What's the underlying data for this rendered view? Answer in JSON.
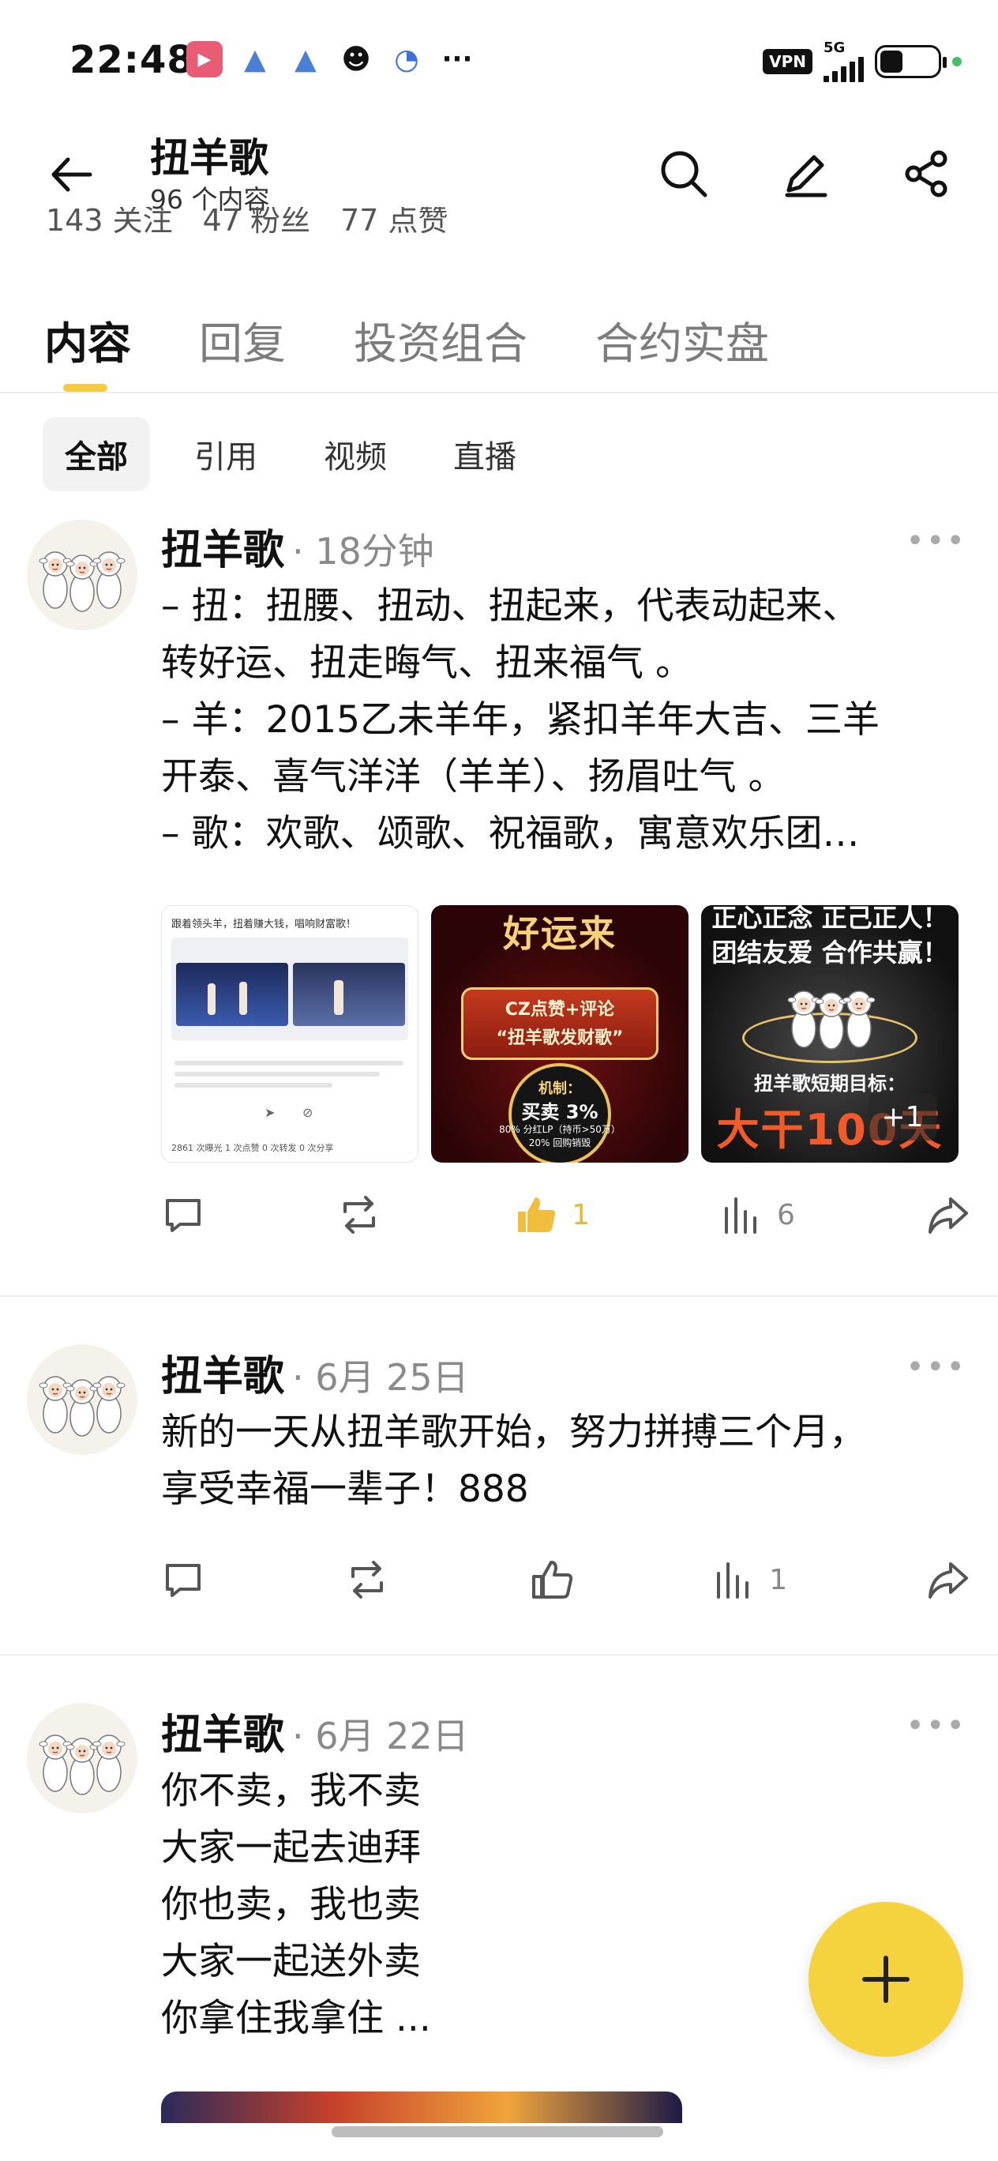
{
  "status_bar": {
    "time": "22:48",
    "vpn": "VPN",
    "network": "5G"
  },
  "header": {
    "title": "扭羊歌",
    "subtitle": "96 个内容"
  },
  "stats": [
    "143 关注",
    "47 粉丝",
    "77 点赞"
  ],
  "tabs": [
    {
      "label": "内容",
      "active": true
    },
    {
      "label": "回复"
    },
    {
      "label": "投资组合"
    },
    {
      "label": "合约实盘"
    }
  ],
  "filters": [
    "全部",
    "引用",
    "视频",
    "直播"
  ],
  "posts": [
    {
      "author": "扭羊歌",
      "time": "· 18分钟",
      "content": "– 扭：扭腰、扭动、扭起来，代表动起来、\n转好运、扭走晦气、扭来福气 。\n– 羊：2015乙未羊年，紧扣羊年大吉、三羊\n开泰、喜气洋洋（羊羊）、扬眉吐气 。\n– 歌：欢歌、颂歌、祝福歌，寓意欢乐团…",
      "images": {
        "img1_caption": "跟着领头羊，扭着赚大钱，唱响财富歌！",
        "img1_stats": "2861 次曝光  1 次点赞  0 次转发  0 次分享",
        "img2_top": "好运来",
        "img2_badge": "CZ点赞+评论\n“扭羊歌发财歌”",
        "img2_mech": "机制：",
        "img2_rate": "买卖 3%",
        "img2_lines": "80% 分红LP（持币>50万）\n20% 回购销毁",
        "img3_top": "正心正念 正己正人！\n团结友爱 合作共赢！",
        "img3_goal": "扭羊歌短期目标：",
        "img3_big": "大干100天",
        "img3_more": "+1"
      },
      "likes": "1",
      "views": "6"
    },
    {
      "author": "扭羊歌",
      "time": "· 6月 25日",
      "content": "新的一天从扭羊歌开始，努力拼搏三个月，\n享受幸福一辈子！888",
      "likes": "",
      "views": "1"
    },
    {
      "author": "扭羊歌",
      "time": "· 6月 22日",
      "content": "你不卖，我不卖\n大家一起去迪拜\n你也卖，我也卖\n大家一起送外卖\n你拿住我拿住 ..."
    }
  ],
  "colors": {
    "accent": "#f5cb41",
    "fab": "#f5d33f",
    "like": "#e8b73b"
  }
}
